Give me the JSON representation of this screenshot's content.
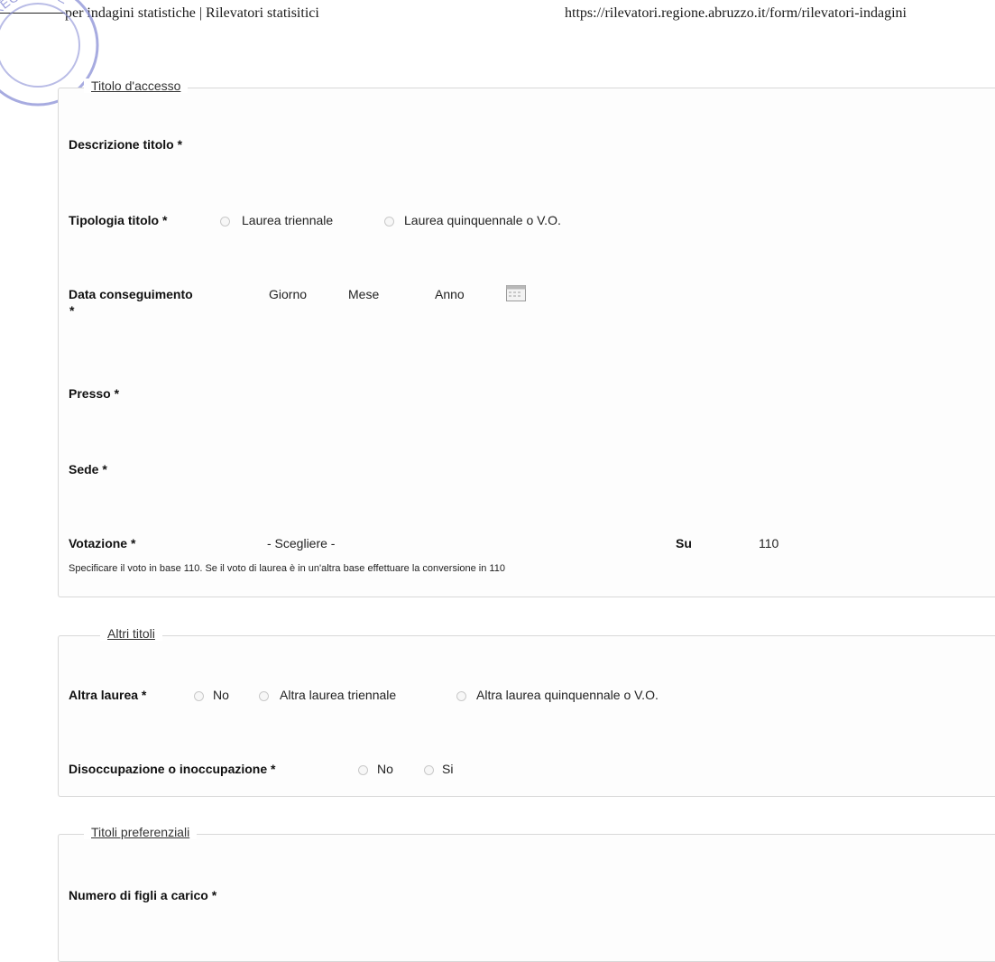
{
  "header": {
    "title": "per indagini statistiche | Rilevatori statisitici",
    "url": "https://rilevatori.regione.abruzzo.it/form/rilevatori-indagini"
  },
  "stamp": {
    "text": "REGIONALE ABRUZZO - STATIS"
  },
  "titolo_accesso": {
    "legend": "Titolo d'accesso",
    "descrizione_label": "Descrizione titolo *",
    "tipologia_label": "Tipologia titolo *",
    "tipologia_options": [
      "Laurea triennale",
      "Laurea quinquennale o V.O."
    ],
    "data_label": "Data conseguimento",
    "data_required": "*",
    "data_parts": [
      "Giorno",
      "Mese",
      "Anno"
    ],
    "presso_label": "Presso *",
    "sede_label": "Sede *",
    "votazione_label": "Votazione *",
    "votazione_select": "- Scegliere -",
    "su_label": "Su",
    "su_value": "110",
    "votazione_help": "Specificare il voto in base 110. Se il voto di laurea è in un'altra base effettuare la conversione in 110"
  },
  "altri_titoli": {
    "legend": "Altri titoli",
    "altra_laurea_label": "Altra laurea *",
    "altra_laurea_options": [
      "No",
      "Altra laurea triennale",
      "Altra laurea quinquennale o V.O."
    ],
    "disoccupazione_label": "Disoccupazione o inoccupazione *",
    "disoccupazione_options": [
      "No",
      "Si"
    ]
  },
  "titoli_preferenziali": {
    "legend": "Titoli preferenziali",
    "figli_label": "Numero di figli a carico *"
  }
}
